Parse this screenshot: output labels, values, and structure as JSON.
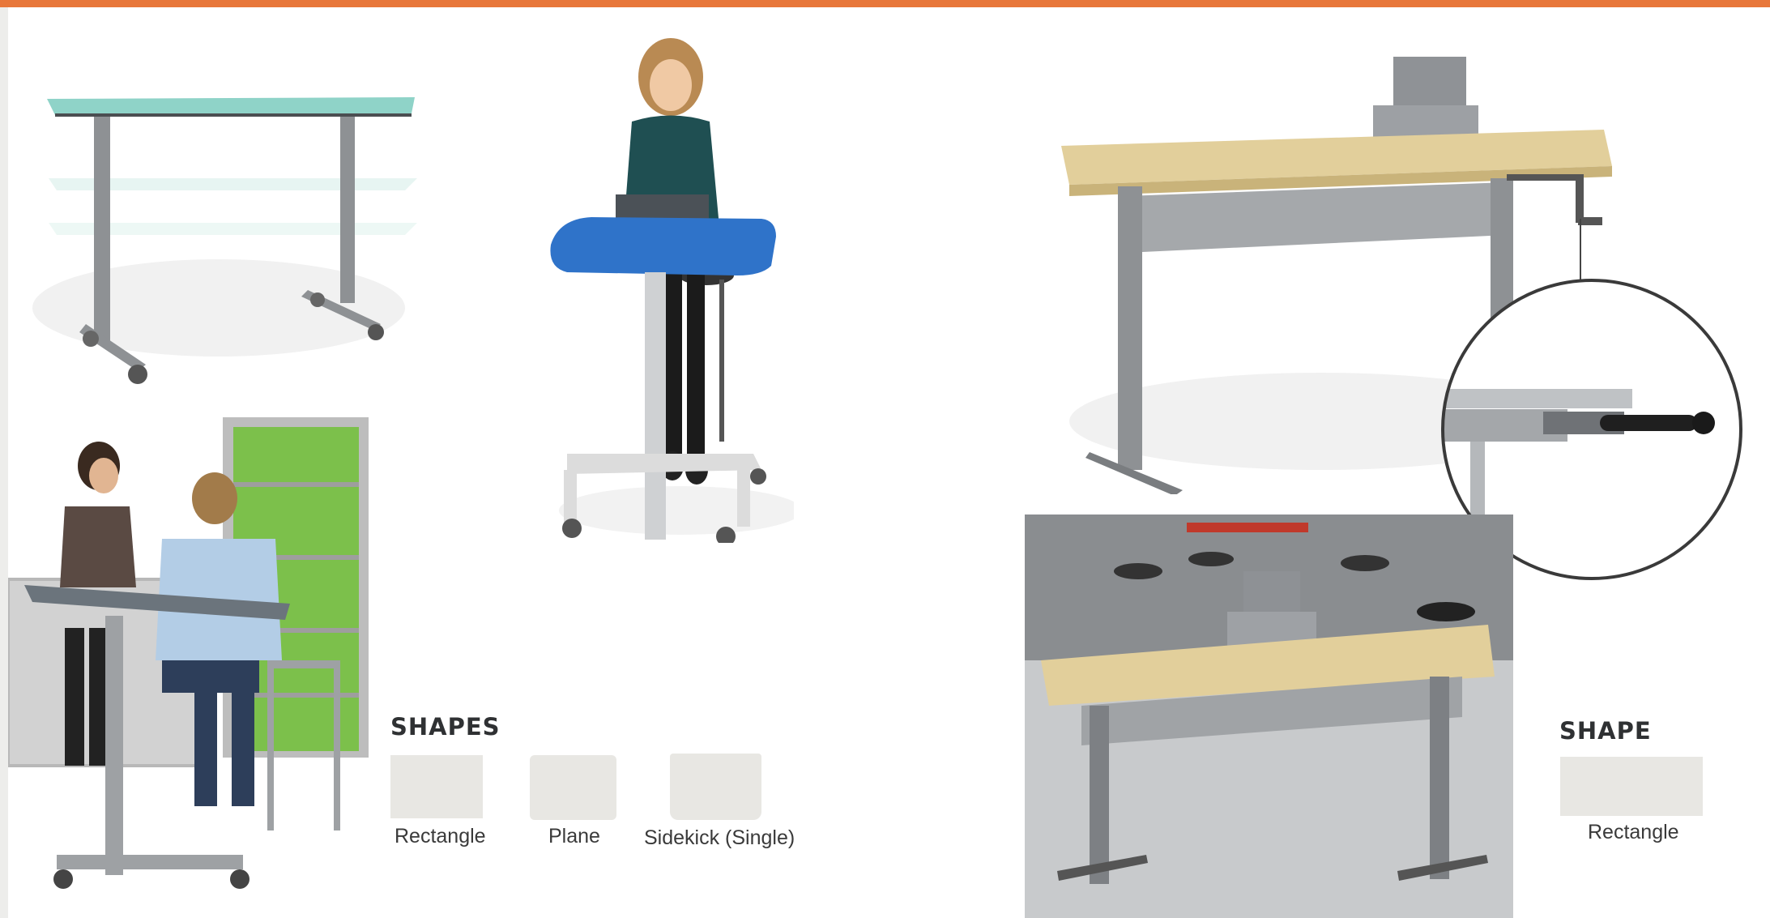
{
  "colors": {
    "accent_bar": "#e8773a",
    "swatch": "#e8e7e3",
    "heading_text": "#2f3133",
    "laminate_top": "#8fd3c8",
    "blue_top": "#2f73c9",
    "butcher_block": "#e2cf9b",
    "frame_gray": "#8e9194"
  },
  "shapes_section": {
    "heading": "SHAPES",
    "items": [
      {
        "label": "Rectangle"
      },
      {
        "label": "Plane"
      },
      {
        "label": "Sidekick (Single)"
      }
    ]
  },
  "shape_section": {
    "heading": "SHAPE",
    "items": [
      {
        "label": "Rectangle"
      }
    ]
  }
}
